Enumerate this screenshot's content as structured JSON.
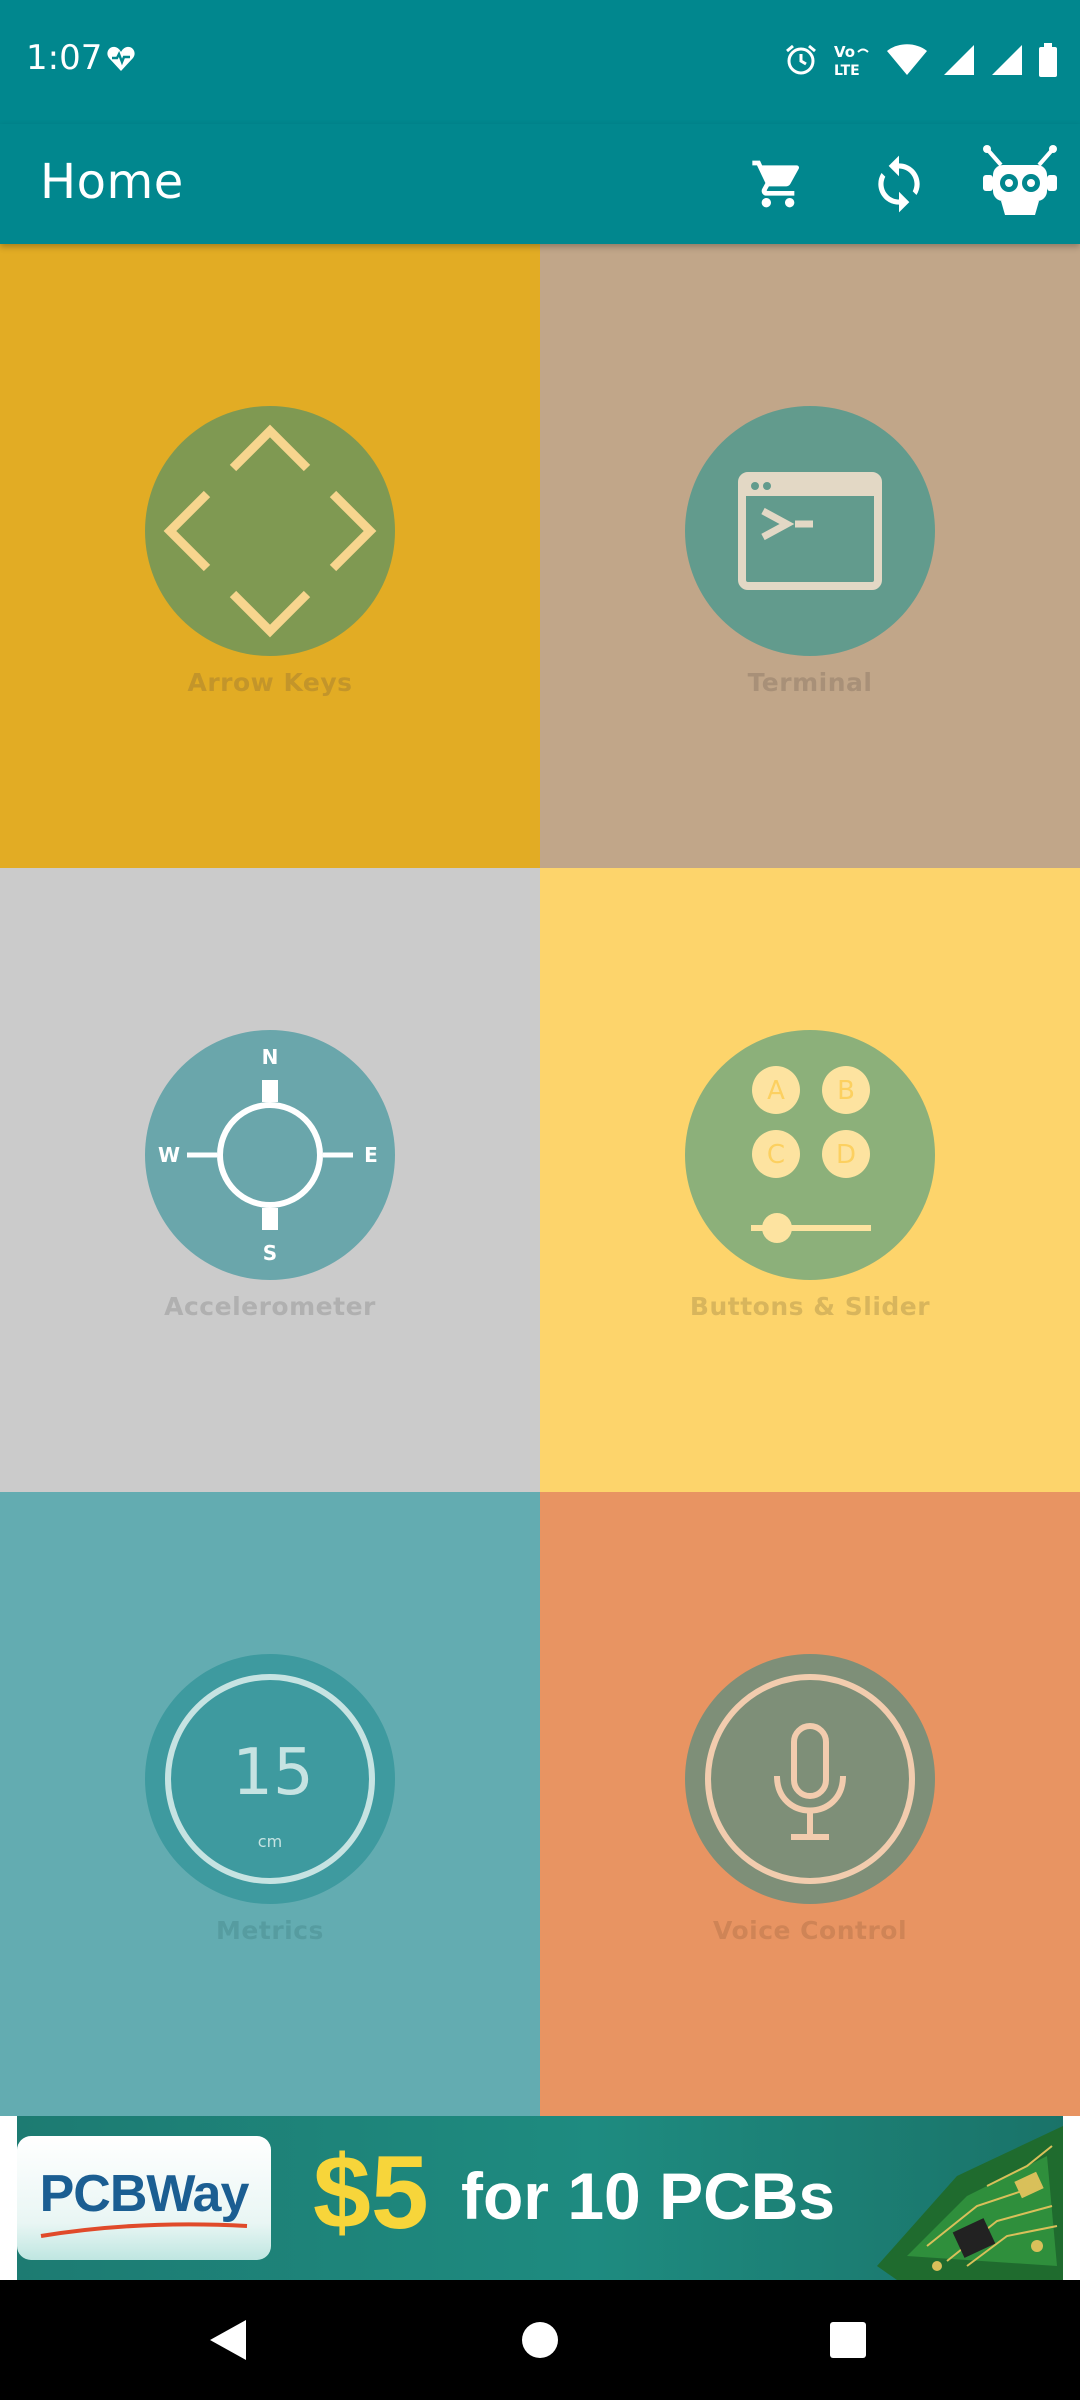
{
  "status_bar": {
    "time": "1:07",
    "icons": [
      "health-heart-icon",
      "alarm-icon",
      "volte-icon",
      "wifi-icon",
      "cell-signal-icon",
      "cell-signal-icon",
      "battery-icon"
    ],
    "volte_top": "Vo",
    "volte_bottom": "LTE",
    "color": "#01878e"
  },
  "app_bar": {
    "title": "Home",
    "actions": [
      "cart-icon",
      "sync-icon",
      "robot-settings-icon"
    ],
    "color": "#01878e"
  },
  "tiles": [
    {
      "id": "arrow-keys",
      "label": "Arrow Keys",
      "icon": "arrow-keys-icon",
      "bg": "#e2ac24",
      "disc": "#7f9952",
      "icon_color": "#f7d58e",
      "label_color": "#c3952a"
    },
    {
      "id": "terminal",
      "label": "Terminal",
      "icon": "terminal-icon",
      "bg": "#c1a689",
      "disc": "#629b8d",
      "icon_color": "#e3d8c5",
      "label_color": "#a89078"
    },
    {
      "id": "accelerometer",
      "label": "Accelerometer",
      "icon": "compass-icon",
      "bg": "#cbcbcb",
      "disc": "#6aa6ab",
      "icon_color": "#ffffff",
      "label_color": "#b0b0b0",
      "compass": {
        "n": "N",
        "s": "S",
        "e": "E",
        "w": "W"
      }
    },
    {
      "id": "buttons-slider",
      "label": "Buttons & Slider",
      "icon": "buttons-slider-icon",
      "bg": "#fdd46b",
      "disc": "#8cb07a",
      "icon_color": "#fde3a0",
      "label_color": "#d8b55c",
      "buttons": [
        "A",
        "B",
        "C",
        "D"
      ]
    },
    {
      "id": "metrics",
      "label": "Metrics",
      "icon": "metrics-gauge-icon",
      "bg": "#63acb1",
      "disc": "#3e9a9f",
      "icon_color": "#c6e3e2",
      "label_color": "#569ca0",
      "metric_value": "15",
      "metric_unit": "cm"
    },
    {
      "id": "voice-control",
      "label": "Voice Control",
      "icon": "microphone-icon",
      "bg": "#e89462",
      "disc": "#7e8f78",
      "icon_color": "#f2ccae",
      "label_color": "#cf8456"
    }
  ],
  "banner": {
    "logo": "PCBWay",
    "price": "$5",
    "text": "for 10 PCBs"
  },
  "nav_bar": {
    "buttons": [
      "back-icon",
      "home-icon",
      "recents-icon"
    ]
  }
}
